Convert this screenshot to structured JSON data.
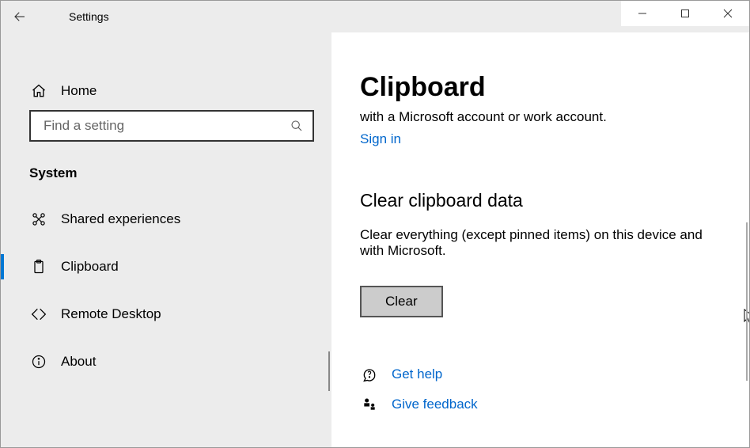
{
  "window": {
    "title": "Settings"
  },
  "sidebar": {
    "home_label": "Home",
    "search_placeholder": "Find a setting",
    "group_label": "System",
    "items": [
      {
        "label": "Shared experiences"
      },
      {
        "label": "Clipboard"
      },
      {
        "label": "Remote Desktop"
      },
      {
        "label": "About"
      }
    ]
  },
  "content": {
    "heading": "Clipboard",
    "subtext": "with a Microsoft account or work account.",
    "signin_label": "Sign in",
    "section_title": "Clear clipboard data",
    "section_desc": "Clear everything (except pinned items) on this device and with Microsoft.",
    "clear_button": "Clear",
    "help_label": "Get help",
    "feedback_label": "Give feedback"
  }
}
